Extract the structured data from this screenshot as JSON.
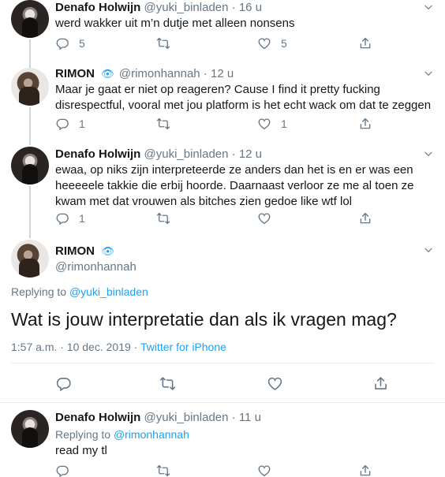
{
  "tweets": [
    {
      "name": "Denafo Holwijn",
      "handle": "@yuki_binladen",
      "time": "16 u",
      "text": "werd wakker uit m’n dutje met alleen nonsens",
      "reply_count": "5",
      "like_count": "5"
    },
    {
      "name": "RIMON",
      "handle": "@rimonhannah",
      "time": "12 u",
      "text": "Maar je gaat er niet op reageren? Cause I find it pretty fucking disrespectful, vooral met jou platform is het echt wack om dat te zeggen",
      "reply_count": "1",
      "like_count": "1"
    },
    {
      "name": "Denafo Holwijn",
      "handle": "@yuki_binladen",
      "time": "12 u",
      "text": "ewaa, op niks zijn interpreteerde ze anders dan het is en er was een heeeeele takkie die erbij hoorde. Daarnaast verloor ze me al toen ze kwam met dat vrouwen als bitches zien gedoe like wtf lol",
      "reply_count": "1",
      "like_count": ""
    }
  ],
  "focused": {
    "name": "RIMON",
    "handle": "@rimonhannah",
    "replying_prefix": "Replying to",
    "replying_to": "@yuki_binladen",
    "text": "Wat is jouw interpretatie dan als ik vragen mag?",
    "timestamp": "1:57 a.m. · 10 dec. 2019 ·",
    "source": "Twitter for iPhone"
  },
  "reply": {
    "name": "Denafo Holwijn",
    "handle": "@yuki_binladen",
    "time": "11 u",
    "replying_prefix": "Replying to",
    "replying_to": "@rimonhannah",
    "text": "read my tl"
  },
  "separator": "·",
  "icons": {
    "verified": "eye-emoji",
    "more": "chevron-down-icon",
    "reply": "comment-icon",
    "retweet": "retweet-icon",
    "like": "heart-icon",
    "share": "share-icon"
  },
  "colors": {
    "link": "#1da1f2",
    "muted": "#657786",
    "text": "#14171a",
    "thread_line": "#ccd6dd"
  }
}
